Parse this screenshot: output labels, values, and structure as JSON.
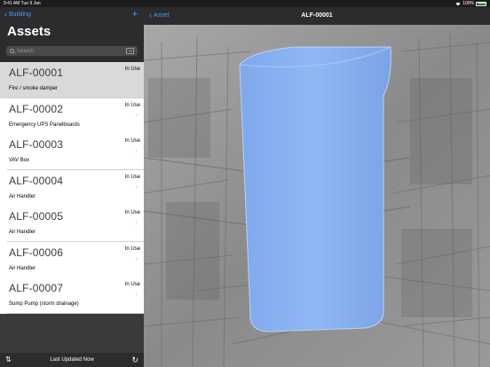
{
  "status_bar": {
    "time_date": "9:41 AM   Tue 9 Jan",
    "battery": "100%"
  },
  "sidebar": {
    "back_label": "Building",
    "add_label": "+",
    "title": "Assets",
    "search_placeholder": "Search",
    "assets": [
      {
        "id": "ALF-00001",
        "status": "In Use",
        "description": "Fire / smoke damper",
        "selected": true
      },
      {
        "id": "ALF-00002",
        "status": "In Use",
        "description": "Emergency UPS Panelboards",
        "selected": false
      },
      {
        "id": "ALF-00003",
        "status": "In Use",
        "description": "VAV Box",
        "selected": false
      },
      {
        "id": "ALF-00004",
        "status": "In Use",
        "description": "Air Handler",
        "selected": false
      },
      {
        "id": "ALF-00005",
        "status": "In Use",
        "description": "Air Handler",
        "selected": false
      },
      {
        "id": "ALF-00006",
        "status": "In Use",
        "description": "Air Handler",
        "selected": false
      },
      {
        "id": "ALF-00007",
        "status": "In Use",
        "description": "Sump Pump (storm drainage)",
        "selected": false
      }
    ],
    "footer": {
      "sort_icon": "sort-icon",
      "last_updated": "Last Updated Now",
      "refresh_icon": "refresh-icon"
    }
  },
  "main": {
    "back_label": "Asset",
    "title": "ALF-00001",
    "model_color": "#8fb8f5"
  },
  "colors": {
    "accent": "#4a9cf0",
    "bar_bg": "#2c2c2e"
  }
}
